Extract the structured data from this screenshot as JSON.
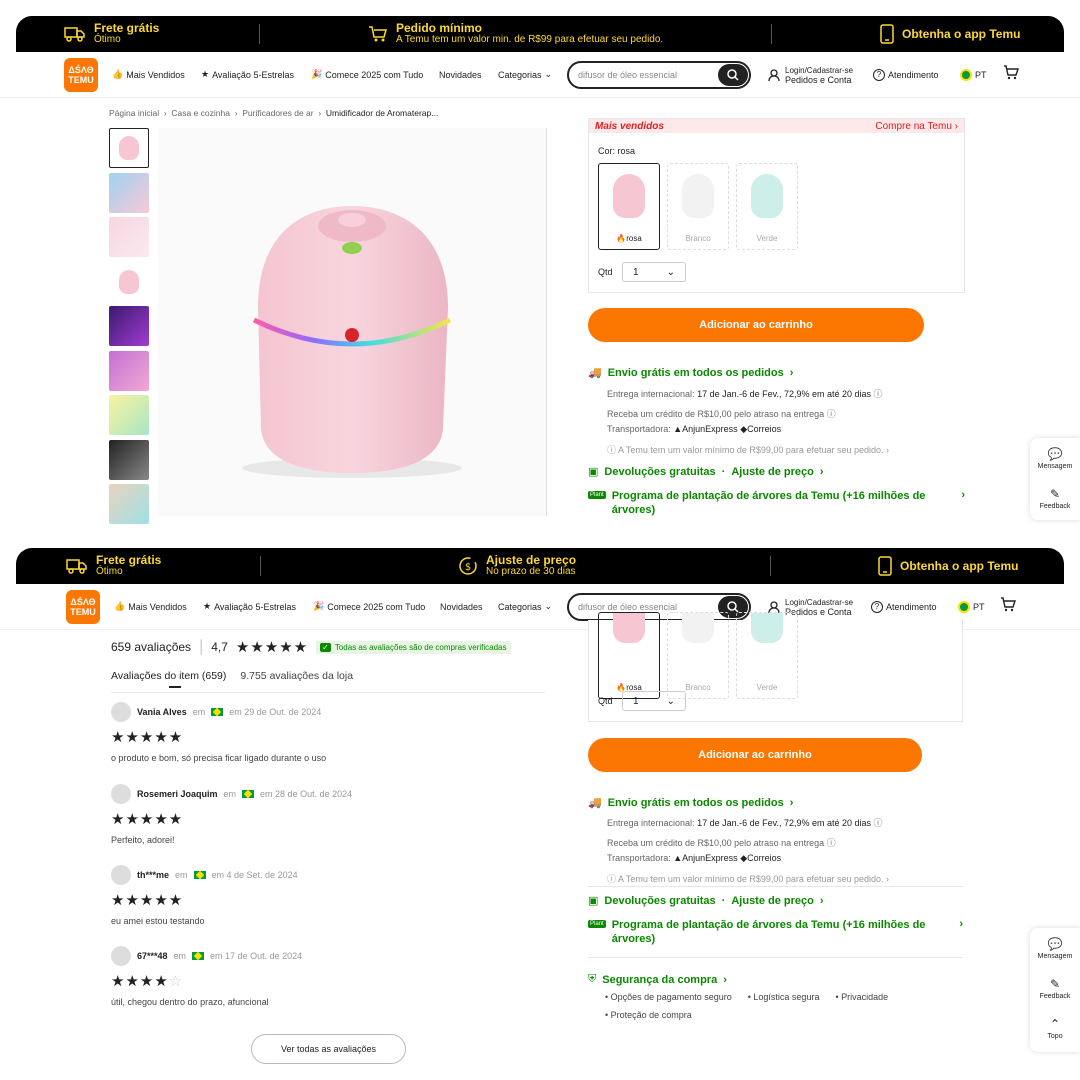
{
  "panel1": {
    "topbar": {
      "left_title": "Frete grátis",
      "left_sub": "Ótimo",
      "mid_title": "Pedido mínimo",
      "mid_sub": "A Temu tem um valor min. de R$99 para efetuar seu pedido.",
      "right": "Obtenha o app Temu"
    }
  },
  "panel2": {
    "topbar": {
      "left_title": "Frete grátis",
      "left_sub": "Ótimo",
      "mid_title": "Ajuste de preço",
      "mid_sub": "No prazo de 30 dias",
      "right": "Obtenha o app Temu"
    }
  },
  "nav": {
    "logo_top": "ΔŚΛΘ",
    "logo_bottom": "TEMU",
    "best_sellers": "Mais Vendidos",
    "five_stars": "Avaliação 5-Estrelas",
    "start_2025": "Comece 2025 com Tudo",
    "news": "Novidades",
    "categories": "Categorias",
    "search_placeholder": "difusor de óleo essencial",
    "login_l1": "Login/Cadastrar-se",
    "login_l2": "Pedidos e Conta",
    "support": "Atendimento",
    "lang": "PT"
  },
  "breadcrumb": [
    "Página inicial",
    "Casa e cozinha",
    "Purificadores de ar",
    "Umidificador de Aromaterap..."
  ],
  "product": {
    "best_seller_label": "Mais vendidos",
    "buy_on_temu": "Compre na Temu",
    "color_label": "Cor: rosa",
    "swatches": [
      "rosa",
      "Branco",
      "Verde"
    ],
    "qty_label": "Qtd",
    "qty_value": "1",
    "add_to_cart": "Adicionar ao carrinho"
  },
  "shipping": {
    "free_ship": "Envio grátis em todos os pedidos",
    "intl_label": "Entrega internacional:",
    "intl_value": "17 de Jan.-6 de Fev., 72,9% em até 20 dias",
    "intl_value_2": "17 de Jan.-6 de Fev., 72,9% em até 20 dias",
    "credit": "Receba um crédito de R$10,00 pelo atraso na entrega",
    "carrier_label": "Transportadora:",
    "carrier_1": "AnjunExpress",
    "carrier_2": "Correios",
    "min_note": "A Temu tem um valor mínimo de R$99,00 para efetuar seu pedido.",
    "returns": "Devoluções gratuitas",
    "price_adjust": "Ajuste de preço",
    "tree_badge": "Plant",
    "tree_program": "Programa de plantação de árvores da Temu (+16 milhões de árvores)",
    "security": "Segurança da compra",
    "sec_items": [
      "Opções de pagamento seguro",
      "Logística segura",
      "Privacidade",
      "Proteção de compra"
    ]
  },
  "side": {
    "message": "Mensagem",
    "feedback": "Feedback",
    "top": "Topo"
  },
  "reviews": {
    "count_label": "659 avaliações",
    "rating": "4,7",
    "verified": "Todas as avaliações são de compras verificadas",
    "tab_item": "Avaliações do item (659)",
    "tab_store": "9.755 avaliações da loja",
    "items": [
      {
        "name": "Vania Alves",
        "where": "em",
        "date": "em 29 de Out. de 2024",
        "stars": 5,
        "text": "o produto e bom, só precisa ficar ligado durante o uso"
      },
      {
        "name": "Rosemeri Joaquim",
        "where": "em",
        "date": "em 28 de Out. de 2024",
        "stars": 5,
        "text": "Perfeito, adorei!"
      },
      {
        "name": "th***me",
        "where": "em",
        "date": "em 4 de Set. de 2024",
        "stars": 5,
        "text": "eu amei estou testando"
      },
      {
        "name": "67***48",
        "where": "em",
        "date": "em 17 de Out. de 2024",
        "stars": 4,
        "text": "útil, chegou dentro do prazo, afuncional"
      }
    ],
    "see_all": "Ver todas as avaliações"
  },
  "colors": {
    "accent": "#fb7701",
    "green": "#0a8800",
    "topbar_text": "#fdd835",
    "best_seller_red": "#e02020"
  }
}
